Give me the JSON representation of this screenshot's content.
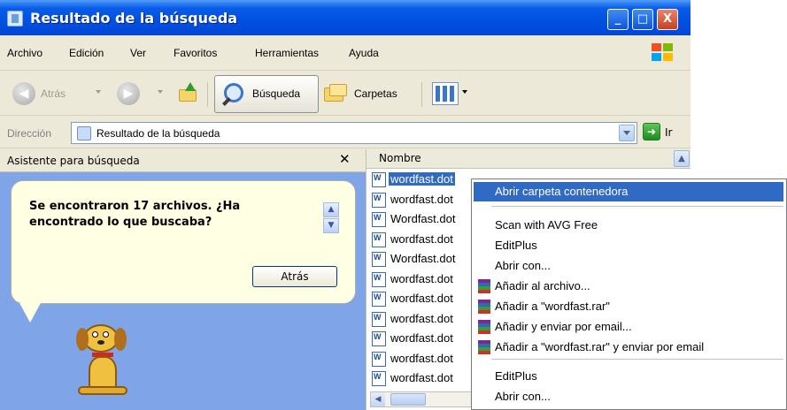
{
  "window": {
    "title": "Resultado de la búsqueda",
    "controls": {
      "minimize": "_",
      "maximize": "□",
      "close": "X"
    }
  },
  "menubar": {
    "items": [
      "Archivo",
      "Edición",
      "Ver",
      "Favoritos",
      "Herramientas",
      "Ayuda"
    ]
  },
  "toolbar": {
    "back_label": "Atrás",
    "search_label": "Búsqueda",
    "folders_label": "Carpetas"
  },
  "addressbar": {
    "label": "Dirección",
    "value": "Resultado de la búsqueda",
    "go_label": "Ir"
  },
  "search_assistant": {
    "title": "Asistente para búsqueda",
    "close_glyph": "✕",
    "message": "Se encontraron 17 archivos. ¿Ha encontrado lo que buscaba?",
    "back_button": "Atrás"
  },
  "file_list": {
    "column_header": "Nombre",
    "rows": [
      {
        "name": "wordfast.dot",
        "selected": true
      },
      {
        "name": "wordfast.dot",
        "selected": false
      },
      {
        "name": "Wordfast.dot",
        "selected": false
      },
      {
        "name": "wordfast.dot",
        "selected": false
      },
      {
        "name": "Wordfast.dot",
        "selected": false
      },
      {
        "name": "wordfast.dot",
        "selected": false
      },
      {
        "name": "wordfast.dot",
        "selected": false
      },
      {
        "name": "wordfast.dot",
        "selected": false
      },
      {
        "name": "wordfast.dot",
        "selected": false
      },
      {
        "name": "wordfast.dot",
        "selected": false
      },
      {
        "name": "wordfast.dot",
        "selected": false
      }
    ]
  },
  "context_menu": {
    "items": [
      {
        "label": "Abrir carpeta contenedora",
        "highlighted": true,
        "icon": ""
      },
      {
        "label": "Scan with AVG Free",
        "highlighted": false,
        "icon": ""
      },
      {
        "label": "EditPlus",
        "highlighted": false,
        "icon": ""
      },
      {
        "label": "Abrir con...",
        "highlighted": false,
        "icon": ""
      },
      {
        "label": "Añadir al archivo...",
        "highlighted": false,
        "icon": "winrar-icon"
      },
      {
        "label": "Añadir a \"wordfast.rar\"",
        "highlighted": false,
        "icon": "winrar-icon"
      },
      {
        "label": "Añadir y enviar por email...",
        "highlighted": false,
        "icon": "winrar-icon"
      },
      {
        "label": "Añadir a \"wordfast.rar\" y enviar por email",
        "highlighted": false,
        "icon": "winrar-icon"
      },
      {
        "label": "EditPlus",
        "highlighted": false,
        "icon": ""
      },
      {
        "label": "Abrir con...",
        "highlighted": false,
        "icon": ""
      }
    ]
  },
  "colors": {
    "titlebar": "#0050e0",
    "selection": "#316ac5",
    "task_pane": "#7fa4e8"
  }
}
